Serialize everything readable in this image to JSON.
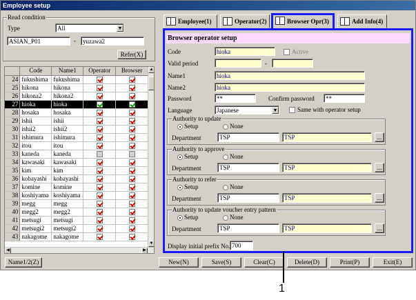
{
  "window": {
    "title": "Employee setup"
  },
  "read_condition": {
    "legend": "Read condition",
    "type_label": "Type",
    "type_value": "All",
    "code_from": "ASIAN_P01",
    "separator": "-",
    "code_to": "yuzawa2",
    "refer_button": "Refer(X)"
  },
  "grid": {
    "columns": [
      "Code",
      "Name1",
      "Operator",
      "Browser"
    ],
    "rows": [
      {
        "no": "24",
        "code": "fukushima",
        "name1": "fukushima",
        "op": true,
        "br": true
      },
      {
        "no": "25",
        "code": "hikona",
        "name1": "hikona",
        "op": true,
        "br": true
      },
      {
        "no": "26",
        "code": "hikona2",
        "name1": "hikona2",
        "op": true,
        "br": true
      },
      {
        "no": "27",
        "code": "hioka",
        "name1": "hioka",
        "op": true,
        "br": true,
        "selected": true
      },
      {
        "no": "28",
        "code": "hosaka",
        "name1": "hosaka",
        "op": true,
        "br": true
      },
      {
        "no": "29",
        "code": "ishii",
        "name1": "ishii",
        "op": true,
        "br": true
      },
      {
        "no": "30",
        "code": "ishii2",
        "name1": "ishii2",
        "op": true,
        "br": true
      },
      {
        "no": "31",
        "code": "ishimura",
        "name1": "ishimura",
        "op": true,
        "br": true
      },
      {
        "no": "32",
        "code": "itou",
        "name1": "itou",
        "op": true,
        "br": true
      },
      {
        "no": "33",
        "code": "kaneda",
        "name1": "kaneda",
        "op": false,
        "br": false
      },
      {
        "no": "34",
        "code": "kawasaki",
        "name1": "kawasaki",
        "op": true,
        "br": true
      },
      {
        "no": "35",
        "code": "kim",
        "name1": "kim",
        "op": true,
        "br": true
      },
      {
        "no": "36",
        "code": "kobayashi",
        "name1": "kobayashi",
        "op": true,
        "br": true
      },
      {
        "no": "37",
        "code": "komine",
        "name1": "komine",
        "op": true,
        "br": true
      },
      {
        "no": "38",
        "code": "koshiyama",
        "name1": "koshiyama",
        "op": true,
        "br": true
      },
      {
        "no": "39",
        "code": "megg",
        "name1": "megg",
        "op": true,
        "br": true
      },
      {
        "no": "40",
        "code": "megg2",
        "name1": "megg2",
        "op": true,
        "br": true
      },
      {
        "no": "41",
        "code": "metsugi",
        "name1": "metsugi",
        "op": true,
        "br": true
      },
      {
        "no": "42",
        "code": "metsugi2",
        "name1": "metsugi2",
        "op": true,
        "br": true
      },
      {
        "no": "43",
        "code": "nakagome",
        "name1": "nakagome",
        "op": true,
        "br": true
      }
    ]
  },
  "tabs": [
    {
      "label": "Employee(1)"
    },
    {
      "label": "Operator(2)"
    },
    {
      "label": "Browser Opr(3)",
      "active": true
    },
    {
      "label": "Add Info(4)"
    }
  ],
  "panel": {
    "title": "Browser operator setup",
    "code_label": "Code",
    "code_value": "hioka",
    "active_label": "Active",
    "valid_label": "Valid period",
    "valid_sep": "-",
    "name1_label": "Name1",
    "name1_value": "hioka",
    "name2_label": "Name2",
    "name2_value": "hioka",
    "password_label": "Password",
    "password_value": "**",
    "confirm_label": "Confirm password",
    "confirm_value": "**",
    "language_label": "Language",
    "language_value": "Japanese",
    "same_label": "Same with operator setup",
    "auth": [
      {
        "legend": "Authority to update",
        "dept_code": "TSP",
        "dept_name": "TSP"
      },
      {
        "legend": "Authority to approve",
        "dept_code": "TSP",
        "dept_name": "TSP"
      },
      {
        "legend": "Authority to refer",
        "dept_code": "TSP",
        "dept_name": "TSP"
      },
      {
        "legend": "Authority to update voucher entry pattern",
        "dept_code": "TSP",
        "dept_name": "TSP"
      }
    ],
    "setup_label": "Setup",
    "none_label": "None",
    "dept_label": "Department",
    "lookup": "...",
    "prefix_label": "Display initial prefix No.",
    "prefix_value": "700"
  },
  "footer": {
    "name_button": "Name1/2(Z)",
    "new": "New(N)",
    "save": "Save(S)",
    "clear": "Clear(C)",
    "delete": "Delete(D)",
    "print": "Print(P)",
    "exit": "Exit(E)"
  },
  "callout": {
    "number": "1"
  },
  "colors": {
    "highlight": "#1a1aff",
    "panel_title_bg": "#ffd9ff",
    "yellow_field": "#ffffd0"
  }
}
